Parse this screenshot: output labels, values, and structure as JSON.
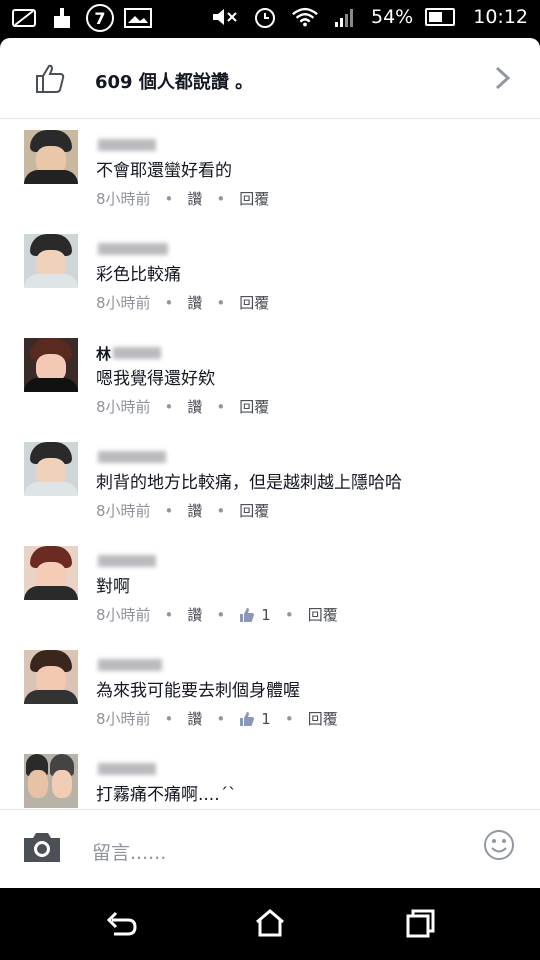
{
  "status_bar": {
    "battery": "54%",
    "time": "10:12",
    "notification_badge": "7"
  },
  "likes": {
    "text": "609 個人都說讚 。"
  },
  "comments": [
    {
      "name_partial": "",
      "text": "不會耶還蠻好看的",
      "time": "8小時前",
      "like_label": "讚",
      "reply_label": "回覆",
      "like_count": ""
    },
    {
      "name_partial": "",
      "text": "彩色比較痛",
      "time": "8小時前",
      "like_label": "讚",
      "reply_label": "回覆",
      "like_count": ""
    },
    {
      "name_partial": "林",
      "text": "嗯我覺得還好欸",
      "time": "8小時前",
      "like_label": "讚",
      "reply_label": "回覆",
      "like_count": ""
    },
    {
      "name_partial": "",
      "text": "刺背的地方比較痛，但是越刺越上隱哈哈",
      "time": "8小時前",
      "like_label": "讚",
      "reply_label": "回覆",
      "like_count": ""
    },
    {
      "name_partial": "",
      "text": "對啊",
      "time": "8小時前",
      "like_label": "讚",
      "reply_label": "回覆",
      "like_count": "1"
    },
    {
      "name_partial": "",
      "text": "為來我可能要去刺個身體喔",
      "time": "8小時前",
      "like_label": "讚",
      "reply_label": "回覆",
      "like_count": "1"
    },
    {
      "name_partial": "",
      "text": "打霧痛不痛啊....´`",
      "time": "",
      "like_label": "",
      "reply_label": "",
      "like_count": ""
    }
  ],
  "composer": {
    "placeholder": "留言......"
  },
  "colors": {
    "link": "#4b4f56",
    "meta": "#90949c",
    "text": "#141823"
  }
}
